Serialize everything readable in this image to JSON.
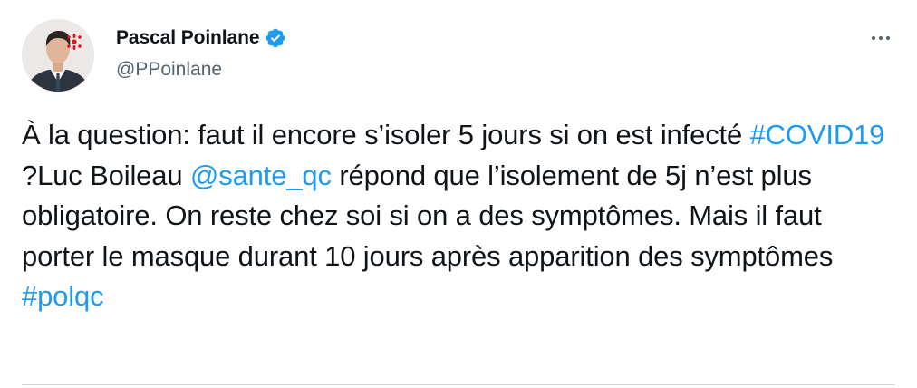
{
  "author": {
    "display_name": "Pascal Poinlane",
    "handle": "@PPoinlane",
    "verified": true
  },
  "menu": {
    "icon": "more-icon"
  },
  "tweet": {
    "segments": [
      {
        "text": "À la question: faut il encore s’isoler 5 jours si on est infecté ",
        "type": "text"
      },
      {
        "text": "#COVID19",
        "type": "hashtag"
      },
      {
        "text": " ?Luc Boileau ",
        "type": "text"
      },
      {
        "text": "@sante_qc",
        "type": "mention"
      },
      {
        "text": " répond que l’isolement de 5j n’est plus obligatoire. On reste chez soi si on a des symptômes. Mais il faut porter le masque durant 10 jours après apparition des symptômes ",
        "type": "text"
      },
      {
        "text": "#polqc",
        "type": "hashtag"
      }
    ]
  },
  "colors": {
    "link": "#1d9bf0",
    "text": "#0f1419",
    "secondary": "#536471",
    "verified": "#1d9bf0",
    "logo": "#e3141b"
  }
}
